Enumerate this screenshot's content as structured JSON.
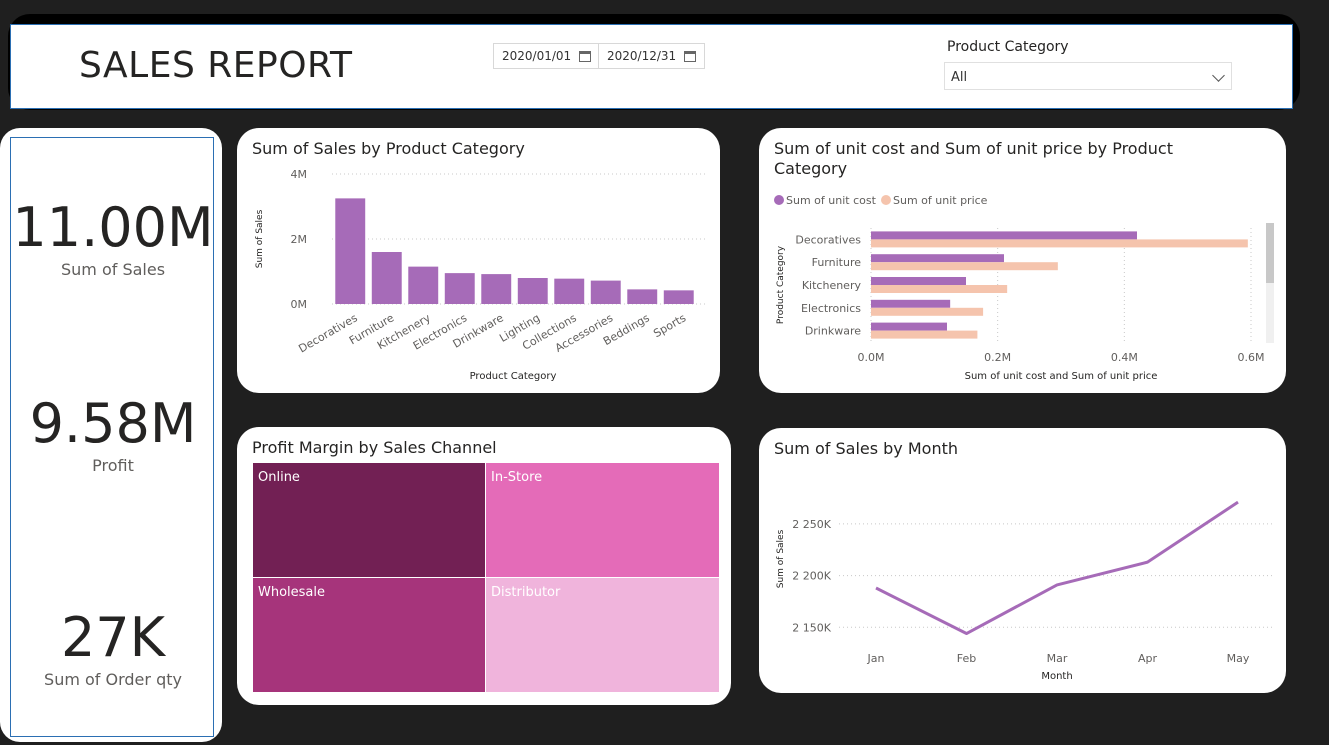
{
  "header": {
    "title": "SALES REPORT",
    "date_start": "2020/01/01",
    "date_end": "2020/12/31",
    "slicer_label": "Product Category",
    "slicer_value": "All"
  },
  "kpis": [
    {
      "value": "11.00M",
      "label": "Sum of Sales"
    },
    {
      "value": "9.58M",
      "label": "Profit"
    },
    {
      "value": "27K",
      "label": "Sum of Order qty"
    }
  ],
  "colors": {
    "purple": "#a66bb8",
    "peach": "#f5c4ad",
    "dark_bg": "#1f1f1f"
  },
  "chart_data": [
    {
      "type": "bar",
      "title": "Sum of Sales by Product Category",
      "xlabel": "Product Category",
      "ylabel": "Sum of Sales",
      "ylim": [
        0,
        4
      ],
      "yticks": [
        "0M",
        "2M",
        "4M"
      ],
      "categories": [
        "Decoratives",
        "Furniture",
        "Kitchenery",
        "Electronics",
        "Drinkware",
        "Lighting",
        "Collections",
        "Accessories",
        "Beddings",
        "Sports"
      ],
      "values": [
        3.25,
        1.6,
        1.15,
        0.95,
        0.92,
        0.8,
        0.78,
        0.72,
        0.45,
        0.42
      ],
      "grid": true
    },
    {
      "type": "bar",
      "orientation": "horizontal",
      "title": "Sum of unit cost and Sum of unit price by Product Category",
      "xlabel": "Sum of unit cost and Sum of unit price",
      "ylabel": "Product Category",
      "xlim": [
        0,
        0.6
      ],
      "xticks": [
        "0.0M",
        "0.2M",
        "0.4M",
        "0.6M"
      ],
      "categories": [
        "Decoratives",
        "Furniture",
        "Kitchenery",
        "Electronics",
        "Drinkware"
      ],
      "series": [
        {
          "name": "Sum of unit cost",
          "values": [
            0.42,
            0.21,
            0.15,
            0.125,
            0.12
          ]
        },
        {
          "name": "Sum of unit price",
          "values": [
            0.595,
            0.295,
            0.215,
            0.177,
            0.168
          ]
        }
      ],
      "legend": "top-left"
    },
    {
      "type": "treemap",
      "title": "Profit Margin by Sales Channel",
      "categories": [
        "Online",
        "In-Store",
        "Wholesale",
        "Distributor"
      ],
      "colors": [
        "#722054",
        "#e46bb8",
        "#a6347b",
        "#f0b4dc"
      ]
    },
    {
      "type": "line",
      "title": "Sum of Sales by Month",
      "xlabel": "Month",
      "ylabel": "Sum of Sales",
      "x": [
        "Jan",
        "Feb",
        "Mar",
        "Apr",
        "May"
      ],
      "values": [
        2188,
        2144,
        2191,
        2213,
        2271
      ],
      "ylim": [
        2130,
        2275
      ],
      "yticks": [
        "2 150K",
        "2 200K",
        "2 250K"
      ],
      "grid": true
    }
  ]
}
